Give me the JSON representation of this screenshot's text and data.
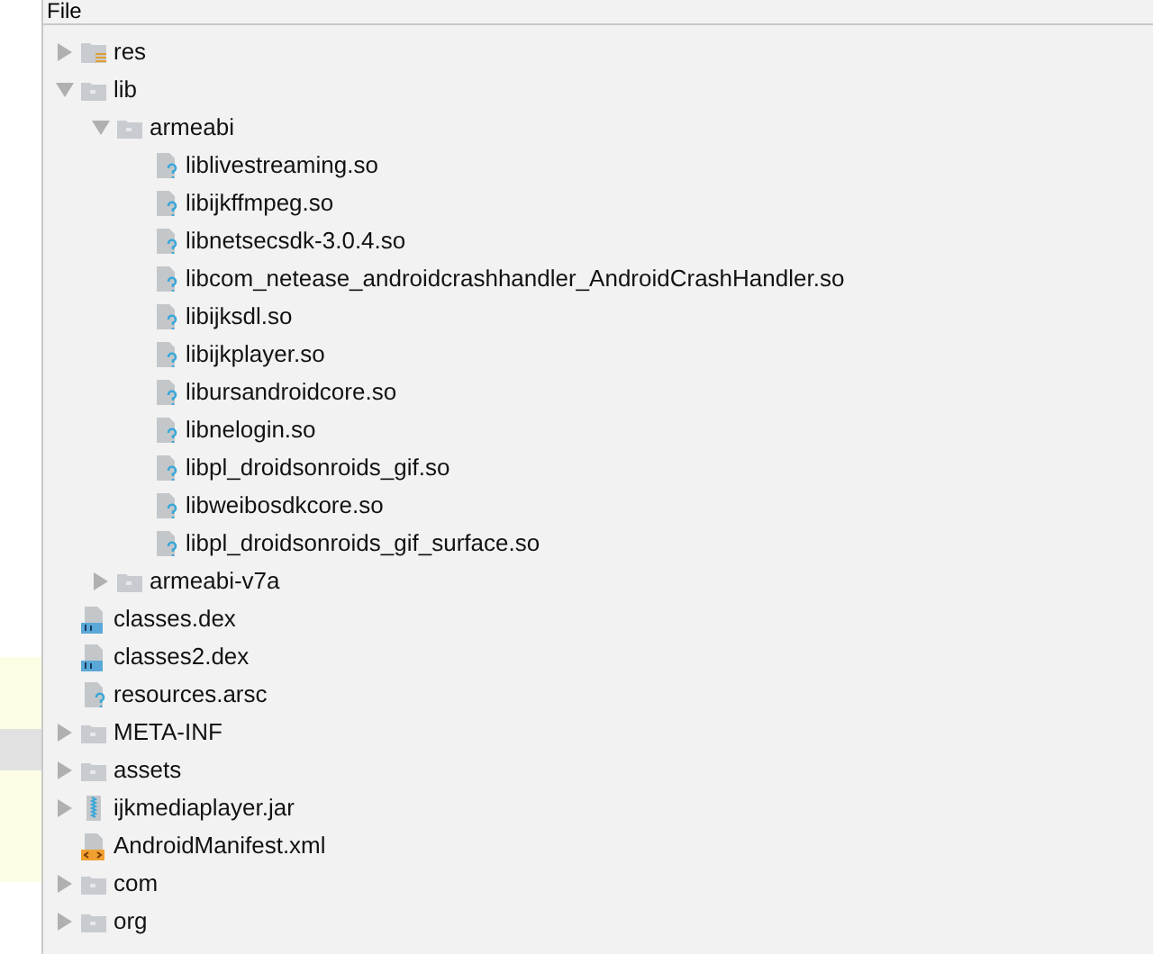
{
  "panel": {
    "title": "File"
  },
  "tree": [
    {
      "label": "res",
      "kind": "resource-folder",
      "expanded": false
    },
    {
      "label": "lib",
      "kind": "folder",
      "expanded": true,
      "children": [
        {
          "label": "armeabi",
          "kind": "folder",
          "expanded": true,
          "children": [
            {
              "label": "liblivestreaming.so",
              "kind": "unknown-file"
            },
            {
              "label": "libijkffmpeg.so",
              "kind": "unknown-file"
            },
            {
              "label": "libnetsecsdk-3.0.4.so",
              "kind": "unknown-file"
            },
            {
              "label": "libcom_netease_androidcrashhandler_AndroidCrashHandler.so",
              "kind": "unknown-file"
            },
            {
              "label": "libijksdl.so",
              "kind": "unknown-file"
            },
            {
              "label": "libijkplayer.so",
              "kind": "unknown-file"
            },
            {
              "label": "libursandroidcore.so",
              "kind": "unknown-file"
            },
            {
              "label": "libnelogin.so",
              "kind": "unknown-file"
            },
            {
              "label": "libpl_droidsonroids_gif.so",
              "kind": "unknown-file"
            },
            {
              "label": "libweibosdkcore.so",
              "kind": "unknown-file"
            },
            {
              "label": "libpl_droidsonroids_gif_surface.so",
              "kind": "unknown-file"
            }
          ]
        },
        {
          "label": "armeabi-v7a",
          "kind": "folder",
          "expanded": false
        }
      ]
    },
    {
      "label": "classes.dex",
      "kind": "dex-file"
    },
    {
      "label": "classes2.dex",
      "kind": "dex-file"
    },
    {
      "label": "resources.arsc",
      "kind": "unknown-file"
    },
    {
      "label": "META-INF",
      "kind": "folder",
      "expanded": false
    },
    {
      "label": "assets",
      "kind": "folder",
      "expanded": false
    },
    {
      "label": "ijkmediaplayer.jar",
      "kind": "jar-file",
      "expanded": false
    },
    {
      "label": "AndroidManifest.xml",
      "kind": "xml-file"
    },
    {
      "label": "com",
      "kind": "folder",
      "expanded": false
    },
    {
      "label": "org",
      "kind": "folder",
      "expanded": false
    }
  ]
}
